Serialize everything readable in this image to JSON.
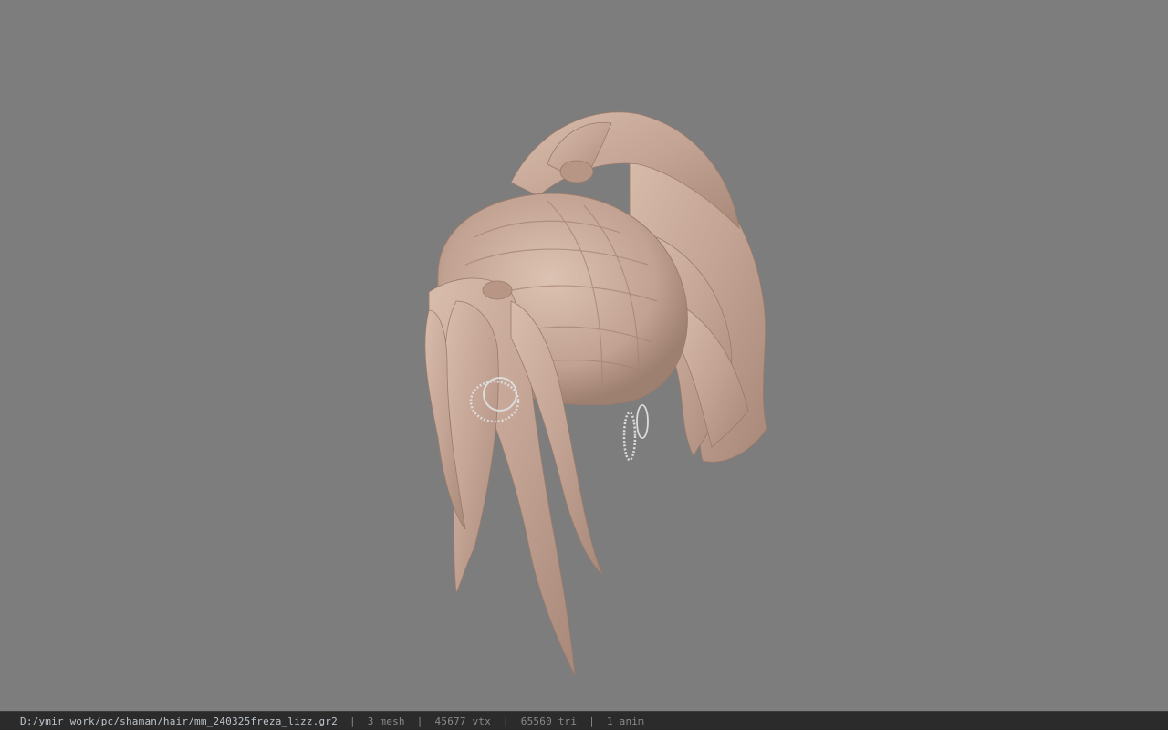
{
  "viewport": {
    "background": "#7d7d7d",
    "subject": "hair-model",
    "hair_color": "#c8a898",
    "earring_color": "#dcdcdc"
  },
  "statusbar": {
    "file_path": "D:/ymir work/pc/shaman/hair/mm_240325freza_lizz.gr2",
    "separator": "|",
    "mesh_count": "3 mesh",
    "vertex_count": "45677 vtx",
    "triangle_count": "65560 tri",
    "anim_count": "1 anim"
  }
}
